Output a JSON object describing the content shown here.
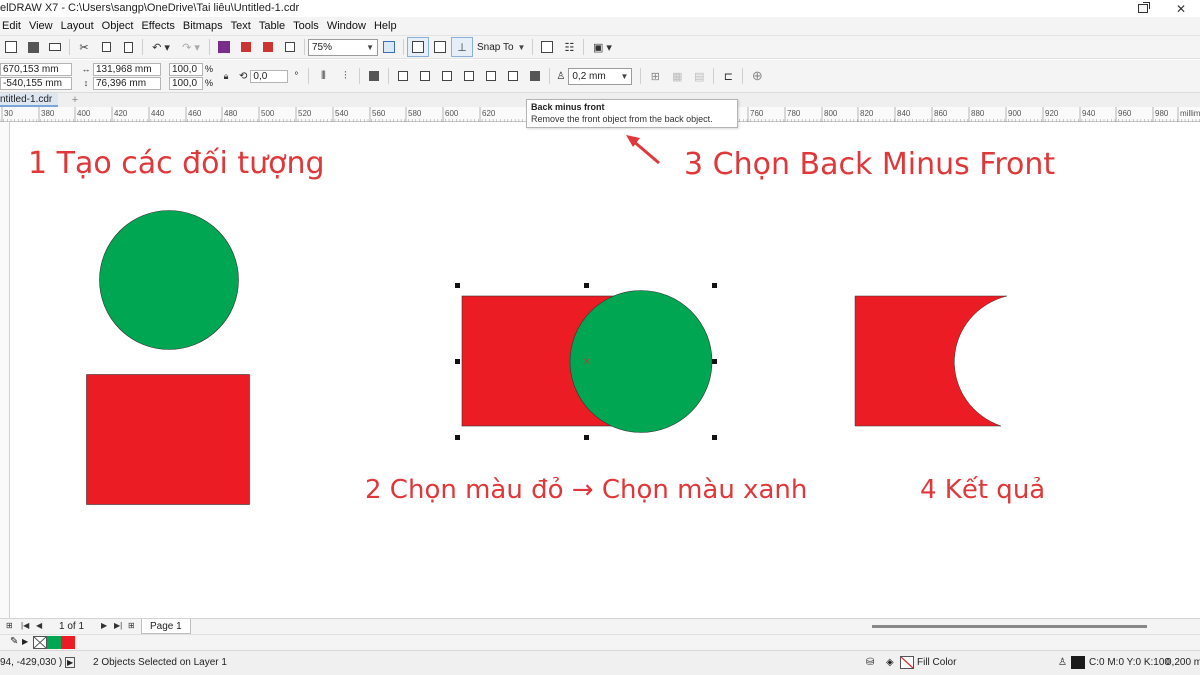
{
  "window": {
    "title": "elDRAW X7 - C:\\Users\\sangp\\OneDrive\\Tai liêu\\Untitled-1.cdr",
    "restore_icon": "restore-icon",
    "close_label": "✕"
  },
  "menu": [
    "Edit",
    "View",
    "Layout",
    "Object",
    "Effects",
    "Bitmaps",
    "Text",
    "Table",
    "Tools",
    "Window",
    "Help"
  ],
  "toolbar": {
    "zoom": "75%",
    "snap_label": "Snap To"
  },
  "property_bar": {
    "x": "670,153 mm",
    "y": "-540,155 mm",
    "width": "131,968 mm",
    "height": "76,396 mm",
    "scale_x": "100,0",
    "scale_y": "100,0",
    "percent": "%",
    "rotation": "0,0",
    "degree": "°",
    "outline_width": "0,2 mm"
  },
  "doc_tab": {
    "label": "ntitled-1.cdr",
    "add": "+"
  },
  "ruler": {
    "ticks": [
      "380",
      "400",
      "420",
      "440",
      "460",
      "480",
      "500",
      "520",
      "540",
      "560",
      "580",
      "600",
      "620",
      "760",
      "780",
      "800",
      "820",
      "840",
      "860",
      "880",
      "900",
      "920",
      "940",
      "960",
      "980"
    ],
    "first": "30",
    "unit": "millim"
  },
  "tooltip": {
    "title": "Back minus front",
    "description": "Remove the front object from the back object."
  },
  "annotations": {
    "step1": "1 Tạo các đối tượng",
    "step2": "2 Chọn màu đỏ → Chọn màu xanh",
    "step3": "3 Chọn Back Minus Front",
    "step4": "4 Kết quả"
  },
  "colors": {
    "red": "#ec1c24",
    "green": "#00a651",
    "annotation": "#e0383a"
  },
  "page_nav": {
    "page_count": "1 of 1",
    "page_tab": "Page 1"
  },
  "status": {
    "coords": "94, -429,030 )",
    "selection": "2 Objects Selected on Layer 1",
    "fill": "Fill Color",
    "outline": "C:0 M:0 Y:0 K:100",
    "outline_width": "0,200 m"
  }
}
